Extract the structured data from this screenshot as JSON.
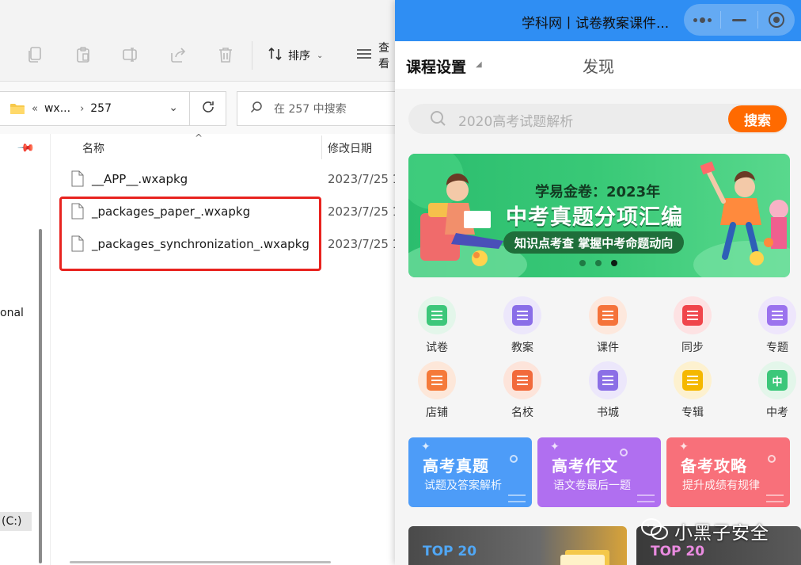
{
  "explorer": {
    "toolbar": {
      "sort_label": "排序",
      "view_label": "查看"
    },
    "address": {
      "overflow": "«",
      "segment_1": "wx...",
      "separator": "›",
      "segment_2": "257"
    },
    "search": {
      "placeholder": "在 257 中搜索"
    },
    "columns": {
      "name": "名称",
      "date": "修改日期"
    },
    "files": [
      {
        "name": "__APP__.wxapkg",
        "date": "2023/7/25 1"
      },
      {
        "name": "_packages_paper_.wxapkg",
        "date": "2023/7/25 1"
      },
      {
        "name": "_packages_synchronization_.wxapkg",
        "date": "2023/7/25 1"
      }
    ],
    "nav": {
      "partial_label": "onal",
      "drive_label": "(C:)"
    },
    "highlight_color": "#e8231f"
  },
  "miniprogram": {
    "title": "学科网丨试卷教案课件...",
    "header": {
      "course_settings": "课程设置",
      "discover": "发现"
    },
    "search": {
      "placeholder": "2020高考试题解析",
      "button": "搜索"
    },
    "banner": {
      "subtitle": "学易金卷：2023年",
      "title": "中考真题分项汇编",
      "tagline": "知识点考查 掌握中考命题动向",
      "slides": 3,
      "active_slide": 3
    },
    "grid": [
      {
        "label": "试卷",
        "icon": "paper-icon",
        "color": "#3cc77a",
        "bg": "#e3f6ea"
      },
      {
        "label": "教案",
        "icon": "lesson-plan-icon",
        "color": "#8a6ee8",
        "bg": "#ece7fb"
      },
      {
        "label": "课件",
        "icon": "courseware-icon",
        "color": "#f5733a",
        "bg": "#fde8dd"
      },
      {
        "label": "同步",
        "icon": "sync-icon",
        "color": "#f0454b",
        "bg": "#fde2e3"
      },
      {
        "label": "专题",
        "icon": "topic-icon",
        "color": "#9b72ee",
        "bg": "#eee6fc"
      },
      {
        "label": "店铺",
        "icon": "shop-icon",
        "color": "#f57a3a",
        "bg": "#fde7d9"
      },
      {
        "label": "名校",
        "icon": "school-icon",
        "color": "#f26a3b",
        "bg": "#fde4da"
      },
      {
        "label": "书城",
        "icon": "bookstore-icon",
        "color": "#8b6fe6",
        "bg": "#ece7fb"
      },
      {
        "label": "专辑",
        "icon": "album-icon",
        "color": "#f5b800",
        "bg": "#fdf1cf"
      },
      {
        "label": "中考",
        "icon": "zhongkao-icon",
        "glyph": "中",
        "color": "#3cc77a",
        "bg": "#e3f6ea"
      }
    ],
    "cards": [
      {
        "title": "高考真题",
        "subtitle": "试题及答案解析",
        "color": "#4d9cf8"
      },
      {
        "title": "高考作文",
        "subtitle": "语文卷最后一题",
        "color": "#b06ff0"
      },
      {
        "title": "备考攻略",
        "subtitle": "提升成绩有规律",
        "color": "#f8707a"
      }
    ],
    "top_cards": [
      {
        "label": "TOP 20",
        "color": "#50a7f5"
      },
      {
        "label": "TOP 20",
        "color": "#ea8be0"
      }
    ]
  },
  "watermark": {
    "text": "小黑子安全"
  }
}
